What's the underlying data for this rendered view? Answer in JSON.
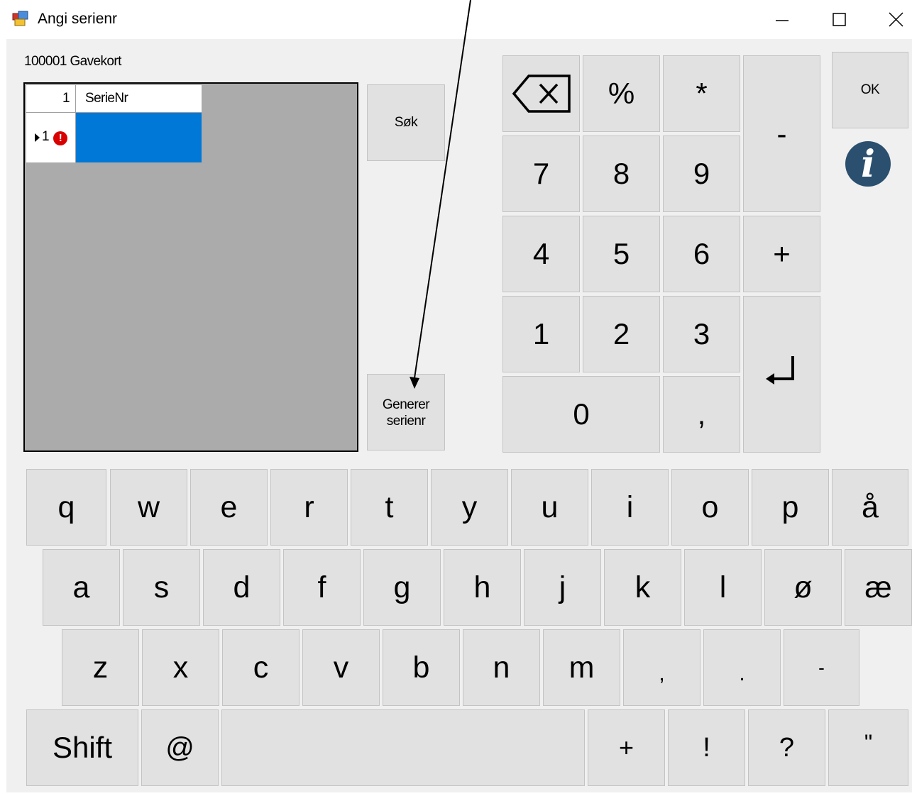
{
  "window": {
    "title": "Angi serienr",
    "minimize_glyph": "minimize-icon",
    "maximize_glyph": "maximize-icon",
    "close_glyph": "close-icon"
  },
  "item_caption": "100001 Gavekort",
  "grid": {
    "corner_label": "1",
    "column_header": "SerieNr",
    "row_number": "1",
    "row_pointer_icon": "row-pointer-icon",
    "row_error_icon": "error-icon",
    "row_error_glyph": "!",
    "selected_cell_value": ""
  },
  "buttons": {
    "search": "Søk",
    "generate_line1": "Generer",
    "generate_line2": "serienr",
    "ok": "OK"
  },
  "numpad": {
    "keys": [
      "%",
      "*",
      "-",
      "7",
      "8",
      "9",
      "4",
      "5",
      "6",
      "+",
      "1",
      "2",
      "3",
      "0",
      ","
    ],
    "backspace_icon": "backspace-icon",
    "enter_icon": "enter-icon"
  },
  "info_icon_glyph": "i",
  "keyboard": {
    "row1": [
      "q",
      "w",
      "e",
      "r",
      "t",
      "y",
      "u",
      "i",
      "o",
      "p",
      "å"
    ],
    "row2": [
      "a",
      "s",
      "d",
      "f",
      "g",
      "h",
      "j",
      "k",
      "l",
      "ø",
      "æ"
    ],
    "row3": [
      "z",
      "x",
      "c",
      "v",
      "b",
      "n",
      "m",
      ",",
      ".",
      "-"
    ],
    "row4": [
      "Shift",
      "@",
      "",
      "+",
      "!",
      "?",
      "\""
    ]
  },
  "colors": {
    "selection": "#0078d7",
    "grid_background": "#ababab",
    "key_face": "#e1e1e1",
    "info_icon": "#2b4f6e",
    "error": "#d80000"
  }
}
